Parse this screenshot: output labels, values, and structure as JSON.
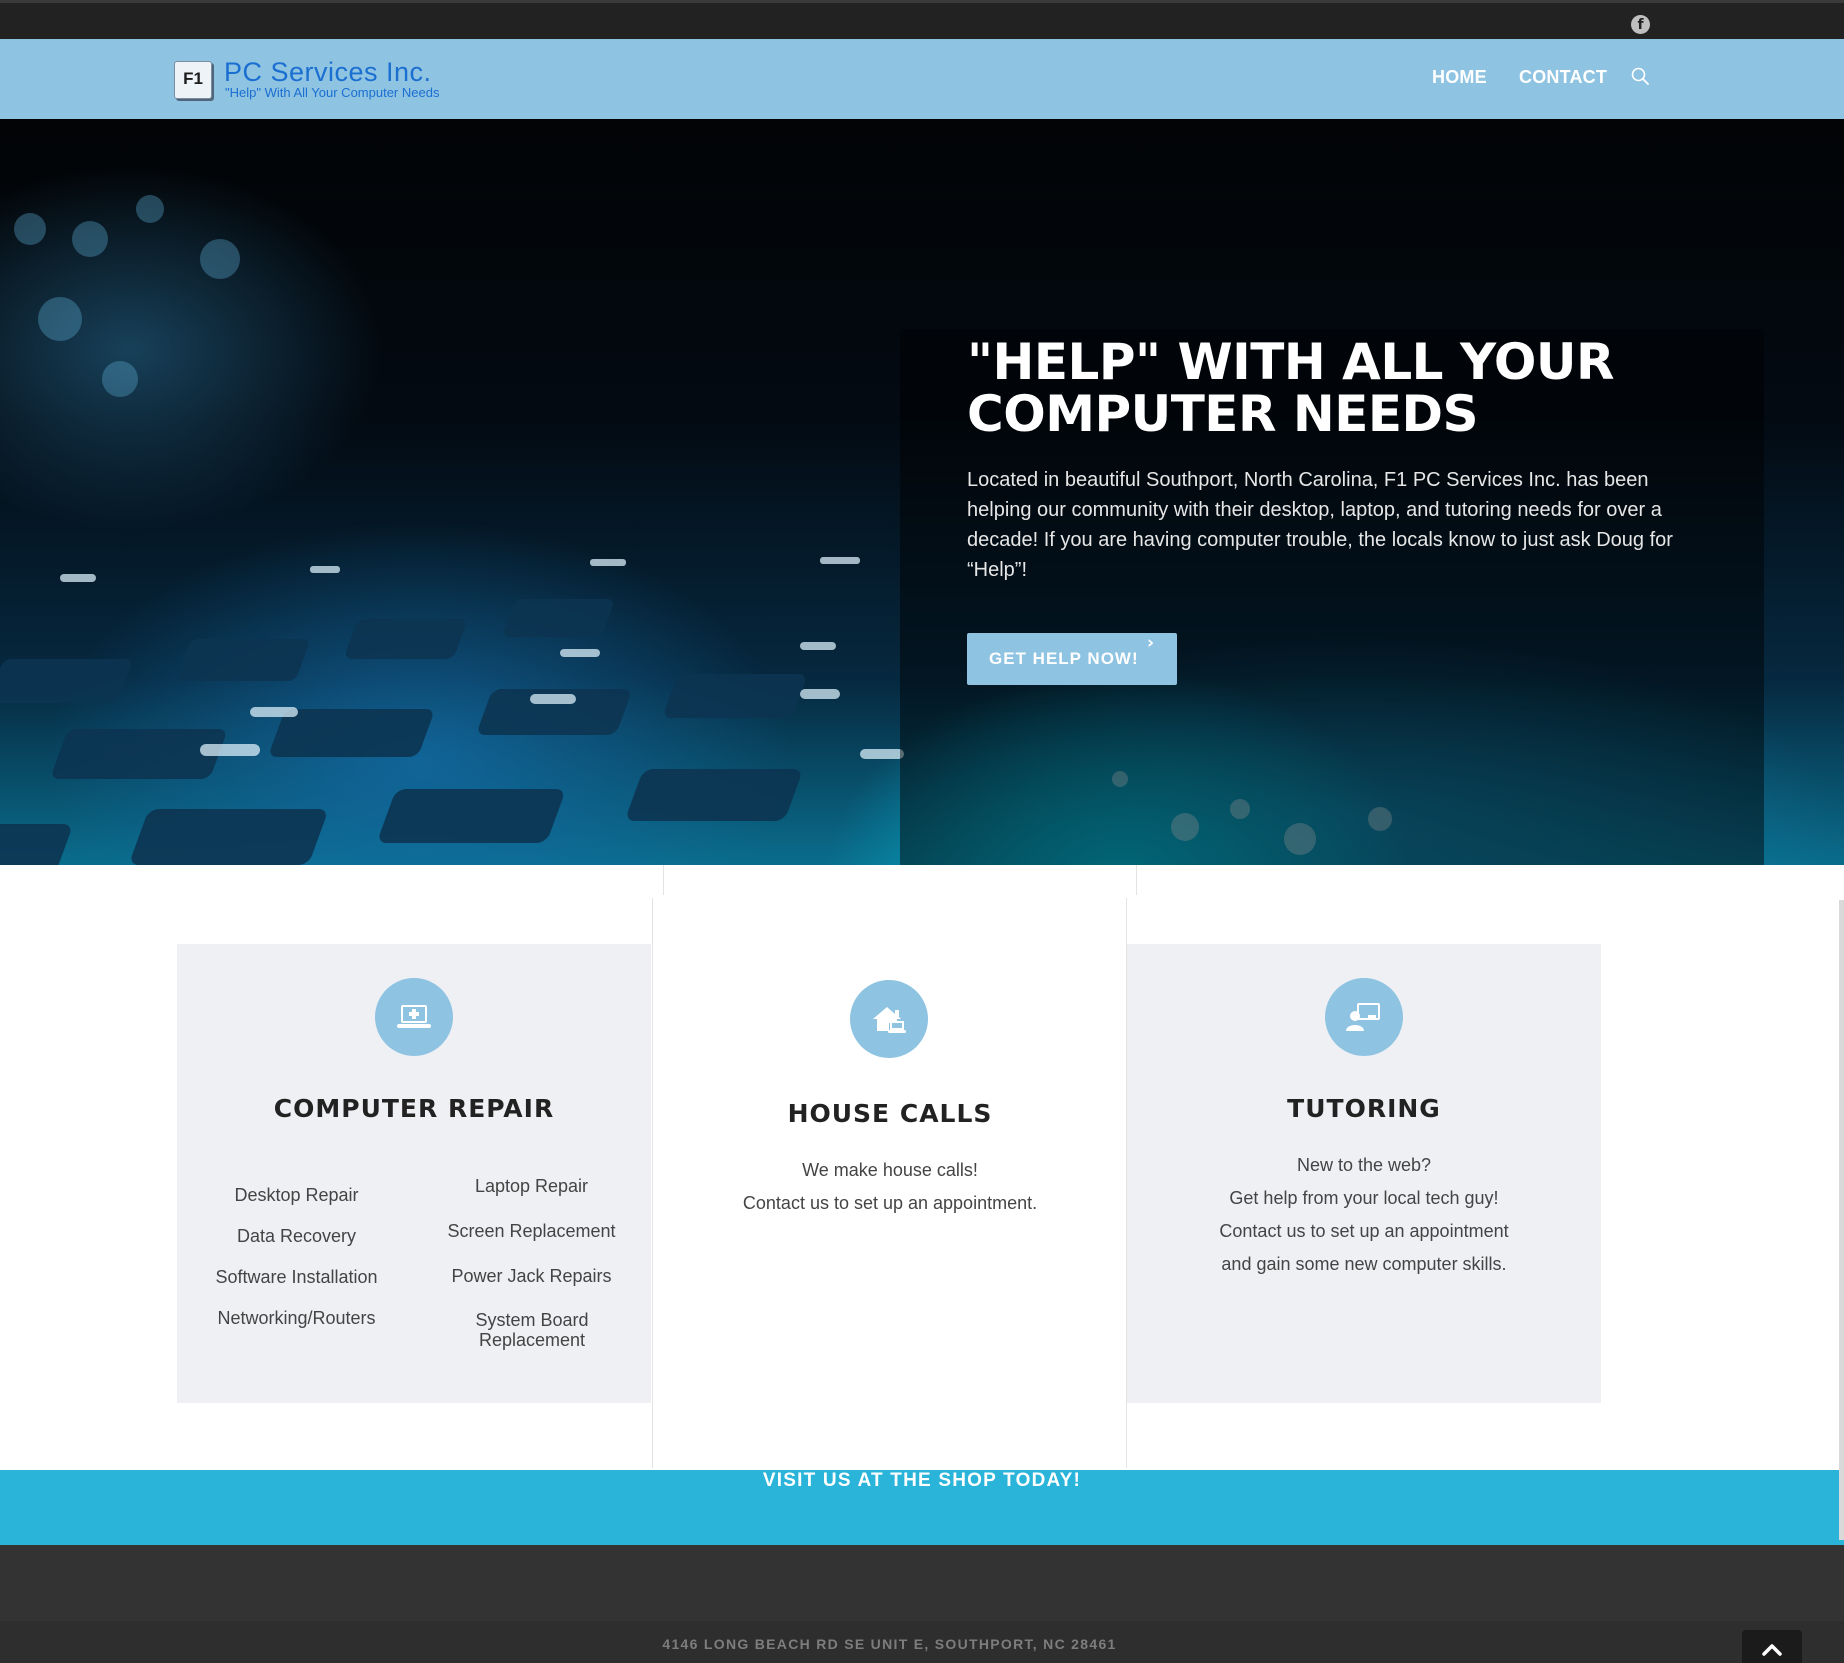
{
  "topbar": {
    "social_icon": "facebook-icon"
  },
  "header": {
    "logo_key": "F1",
    "logo_name": "PC Services Inc.",
    "logo_tagline": "\"Help\" With All Your Computer Needs",
    "nav": {
      "home": "HOME",
      "contact": "CONTACT"
    },
    "search_icon": "search-icon"
  },
  "hero": {
    "title": "\"HELP\" WITH ALL YOUR COMPUTER NEEDS",
    "text": "Located in beautiful Southport, North Carolina, F1 PC Services Inc. has been helping our community with their desktop, laptop, and tutoring needs for over a decade! If you are having computer trouble, the locals know to just ask Doug for “Help”!",
    "button_label": "GET HELP NOW!",
    "button_icon": "chevron-right-icon"
  },
  "services": {
    "repair": {
      "title": "COMPUTER REPAIR",
      "icon": "laptop-medical-icon",
      "left_items": [
        "Desktop Repair",
        "Data Recovery",
        "Software Installation",
        "Networking/Routers"
      ],
      "right_items": [
        "Laptop Repair",
        "Screen Replacement",
        "Power Jack Repairs",
        "System Board Replacement"
      ]
    },
    "house": {
      "title": "HOUSE CALLS",
      "icon": "house-laptop-icon",
      "lines": [
        "We make house calls!",
        "Contact us to set up an appointment."
      ]
    },
    "tutoring": {
      "title": "TUTORING",
      "icon": "chalkboard-user-icon",
      "lines": [
        "New to the web?",
        "Get help from your local tech guy!",
        "Contact us to set up an appointment",
        "and gain some new computer skills."
      ]
    }
  },
  "cta": {
    "label": "VISIT US AT THE SHOP TODAY!"
  },
  "footer": {
    "address": "4146 LONG BEACH RD SE UNIT E, SOUTHPORT, NC 28461",
    "top_icon": "chevron-up-icon"
  },
  "colors": {
    "header": "#8ec3e2",
    "accent": "#2ab4da",
    "topbar": "#222222",
    "footer": "#333333",
    "card": "#eff0f4"
  }
}
